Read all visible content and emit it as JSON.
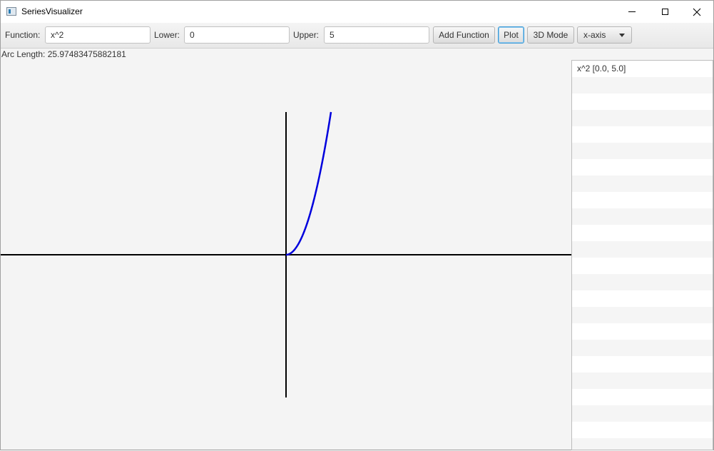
{
  "window": {
    "title": "SeriesVisualizer"
  },
  "toolbar": {
    "function_label": "Function:",
    "function_value": "x^2",
    "lower_label": "Lower:",
    "lower_value": "0",
    "upper_label": "Upper:",
    "upper_value": "5",
    "add_function_label": "Add Function",
    "plot_label": "Plot",
    "mode_3d_label": "3D Mode",
    "axis_selected": "x-axis"
  },
  "status": {
    "arc_length": "Arc Length: 25.97483475882181"
  },
  "function_list": {
    "items": [
      "x^2 [0.0, 5.0]"
    ]
  },
  "colors": {
    "curve": "#0000dd",
    "axes": "#000000"
  },
  "chart_data": {
    "type": "line",
    "function": "x^2",
    "domain": [
      0,
      5
    ],
    "series": [
      {
        "x": [
          0,
          0.5,
          1,
          1.5,
          2,
          2.5,
          3,
          3.5,
          4,
          4.5,
          5
        ],
        "values": [
          0,
          0.25,
          1,
          2.25,
          4,
          6.25,
          9,
          12.25,
          16,
          20.25,
          25
        ]
      }
    ]
  }
}
